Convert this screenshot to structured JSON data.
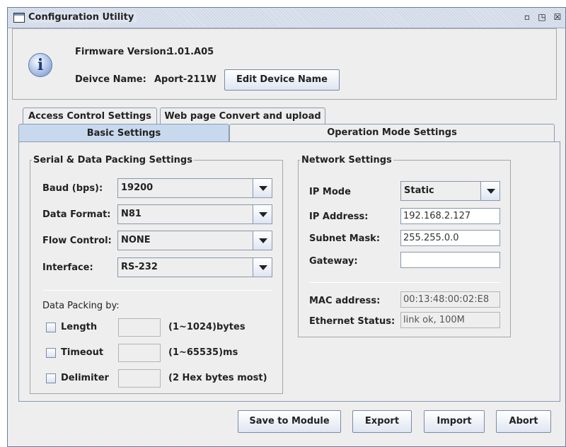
{
  "window": {
    "title": "Configuration Utility",
    "buttons": {
      "minimize": "▫",
      "maximize": "◳",
      "close": "☒"
    }
  },
  "header": {
    "firmware_label": "Firmware Version:",
    "firmware_value": "1.01.A05",
    "device_label": "Deivce Name:",
    "device_value": "Aport-211W",
    "edit_button": "Edit Device Name",
    "icon_glyph": "i"
  },
  "tabs": {
    "row1": [
      "Access Control Settings",
      "Web page Convert and upload"
    ],
    "row2": [
      "Basic Settings",
      "Operation Mode Settings"
    ],
    "selected": "Basic Settings"
  },
  "serial": {
    "legend": "Serial & Data Packing Settings",
    "baud_label": "Baud (bps):",
    "baud_value": "19200",
    "format_label": "Data Format:",
    "format_value": "N81",
    "flow_label": "Flow Control:",
    "flow_value": "NONE",
    "interface_label": "Interface:",
    "interface_value": "RS-232",
    "packing_label": "Data Packing by:",
    "length_label": "Length",
    "length_value": "",
    "length_hint": "(1~1024)bytes",
    "timeout_label": "Timeout",
    "timeout_value": "",
    "timeout_hint": "(1~65535)ms",
    "delimiter_label": "Delimiter",
    "delimiter_value": "",
    "delimiter_hint": "(2 Hex bytes most)"
  },
  "network": {
    "legend": "Network Settings",
    "ipmode_label": "IP Mode",
    "ipmode_value": "Static",
    "ip_label": "IP Address:",
    "ip_value": "192.168.2.127",
    "subnet_label": "Subnet Mask:",
    "subnet_value": "255.255.0.0",
    "gateway_label": "Gateway:",
    "gateway_value": "",
    "mac_label": "MAC address:",
    "mac_value": "00:13:48:00:02:E8",
    "status_label": "Ethernet Status:",
    "status_value": "link ok, 100M"
  },
  "footer": {
    "save": "Save to Module",
    "export": "Export",
    "import": "Import",
    "abort": "Abort"
  }
}
